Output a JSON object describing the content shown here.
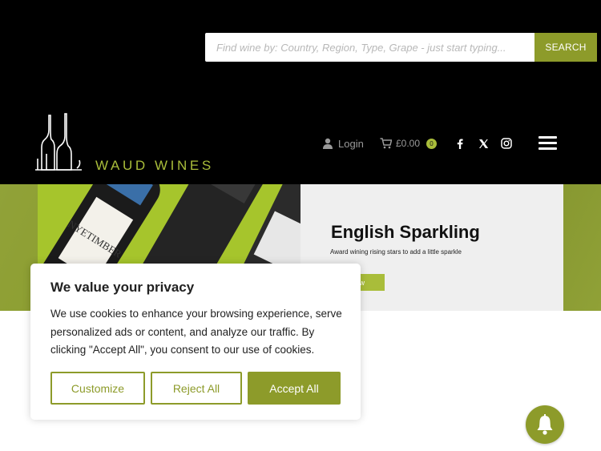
{
  "search": {
    "placeholder": "Find wine by: Country, Region, Type, Grape - just start typing...",
    "button_label": "SEARCH"
  },
  "header": {
    "logo_text": "WAUD WINES",
    "login_label": "Login",
    "cart_total": "£0.00",
    "cart_count": "0",
    "social_icons": [
      "facebook-icon",
      "x-twitter-icon",
      "instagram-icon"
    ],
    "menu_icon": "hamburger-menu-icon"
  },
  "slide": {
    "title": "English Sparkling",
    "subtitle": "Award wining rising stars to add a little sparkle",
    "button_label": "Now",
    "image_label": "NYETIMBER"
  },
  "cookie": {
    "title": "We value your privacy",
    "text": "We use cookies to enhance your browsing experience, serve personalized ads or content, and analyze our traffic. By clicking \"Accept All\", you consent to our use of cookies.",
    "customize_label": "Customize",
    "reject_label": "Reject All",
    "accept_label": "Accept All"
  },
  "colors": {
    "accent": "#8d9b2a",
    "logo_green": "#a9bd3a",
    "header_bg": "#000000"
  }
}
